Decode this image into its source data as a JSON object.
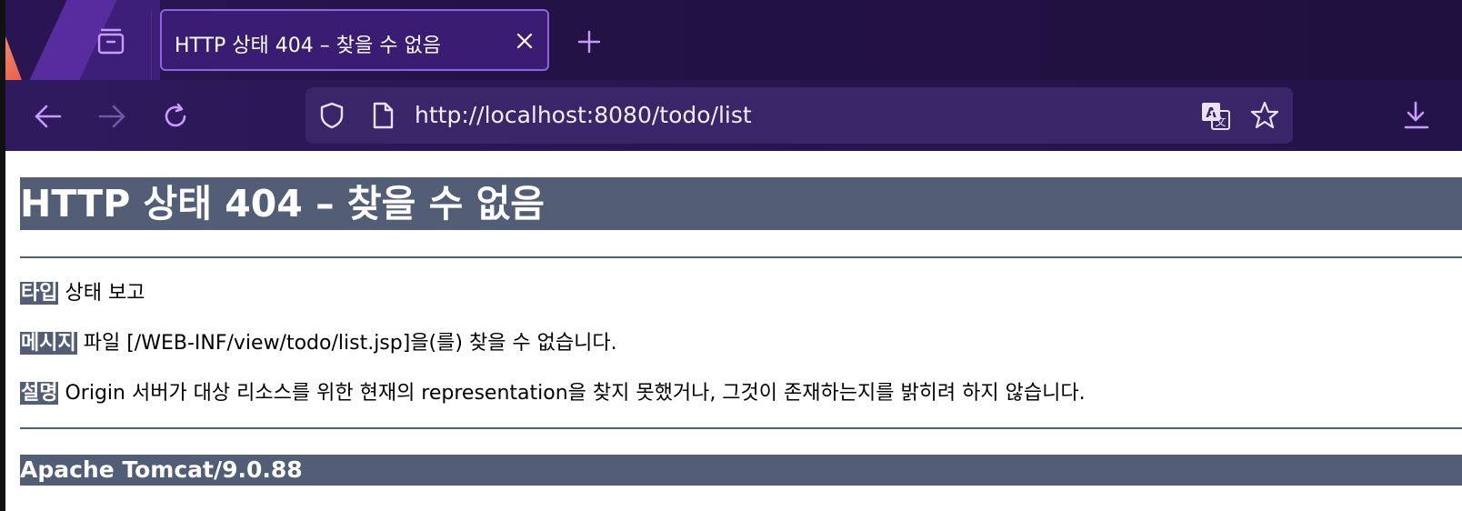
{
  "browser": {
    "tab": {
      "title": "HTTP 상태 404 – 찾을 수 없음"
    },
    "url": "http://localhost:8080/todo/list",
    "icons": {
      "tab_list": "tab-list-icon",
      "tab_close": "close-icon",
      "new_tab": "plus-icon",
      "back": "arrow-left-icon",
      "forward": "arrow-right-icon",
      "reload": "reload-icon",
      "security": "shield-icon",
      "page_info": "page-icon",
      "translate": "translate-icon",
      "bookmark": "star-icon",
      "downloads": "download-icon"
    },
    "colors": {
      "chrome_bg": "#231244",
      "accent": "#b98cff",
      "tab_border": "#8e63e0"
    }
  },
  "page": {
    "heading": "HTTP 상태 404 – 찾을 수 없음",
    "type_label": "타입",
    "type_value": "상태 보고",
    "message_label": "메시지",
    "message_value": "파일 [/WEB-INF/view/todo/list.jsp]을(를) 찾을 수 없습니다.",
    "description_label": "설명",
    "description_value": "Origin 서버가 대상 리소스를 위한 현재의 representation을 찾지 못했거나, 그것이 존재하는지를 밝히려 하지 않습니다.",
    "footer": "Apache Tomcat/9.0.88",
    "colors": {
      "header_bg": "#525d76",
      "header_text": "#ffffff"
    }
  }
}
